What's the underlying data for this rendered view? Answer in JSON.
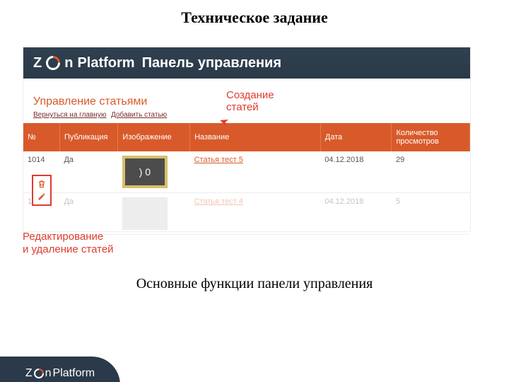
{
  "slide_title": "Техническое задание",
  "caption": "Основные функции панели управления",
  "brand": {
    "zen_prefix": "Z",
    "zen_suffix": "n",
    "platform": "Platform",
    "panel": "Панель управления"
  },
  "page_heading": "Управление статьями",
  "links": {
    "back": "Вернуться на главную",
    "add": "Добавить статью"
  },
  "annot_create": "Создание\nстатей",
  "annot_edit": "Редактирование\nи удаление статей",
  "table": {
    "headers": {
      "num": "№",
      "pub": "Публикация",
      "img": "Изображение",
      "title": "Название",
      "date": "Дата",
      "views": "Количество просмотров"
    },
    "rows": [
      {
        "num": "1014",
        "pub": "Да",
        "thumb": ") 0",
        "title": "Статья тест 5",
        "date": "04.12.2018",
        "views": "29"
      },
      {
        "num": "1013",
        "pub": "Да",
        "thumb": "",
        "title": "Статья тест 4",
        "date": "04.12.2018",
        "views": "5"
      }
    ]
  },
  "footer_brand": {
    "zen_prefix": "Z",
    "zen_suffix": "n",
    "platform": "Platform"
  }
}
